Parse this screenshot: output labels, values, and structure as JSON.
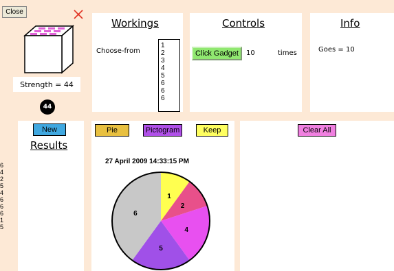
{
  "close_button": "Close",
  "dice": {
    "strength_text": "Strength = 44",
    "badge_value": "44"
  },
  "workings": {
    "title": "Workings",
    "choose_label": "Choose-from",
    "list_items": [
      "1",
      "2",
      "3",
      "4",
      "5",
      "6",
      "6",
      "6"
    ]
  },
  "controls": {
    "title": "Controls",
    "click_button": "Click Gadget",
    "times_value": "10",
    "times_label": "times"
  },
  "info": {
    "title": "Info",
    "goes_text": "Goes = 10"
  },
  "results": {
    "new_button": "New",
    "title": "Results",
    "values": [
      "6",
      "4",
      "2",
      "5",
      "4",
      "6",
      "6",
      "6",
      "1",
      "5"
    ]
  },
  "chart_panel": {
    "pie_button": "Pie",
    "pictogram_button": "Pictogram",
    "keep_button": "Keep",
    "timestamp": "27 April 2009 14:33:15 PM"
  },
  "right_panel": {
    "clear_all_button": "Clear All"
  },
  "colors": {
    "background": "#fde9d6",
    "pie_button": "#e8c040",
    "pictogram_button": "#b050e8",
    "keep_button": "#ffff60",
    "clear_all_button": "#f080e0",
    "new_button": "#40a8e0",
    "click_gadget_button": "#90e870"
  },
  "chart_data": {
    "type": "pie",
    "slices": [
      {
        "label": "1",
        "value": 1,
        "color": "#ffff50"
      },
      {
        "label": "2",
        "value": 1,
        "color": "#e8508a"
      },
      {
        "label": "4",
        "value": 2,
        "color": "#e850f0"
      },
      {
        "label": "5",
        "value": 2,
        "color": "#a050e8"
      },
      {
        "label": "6",
        "value": 4,
        "color": "#c8c8c8"
      }
    ]
  }
}
